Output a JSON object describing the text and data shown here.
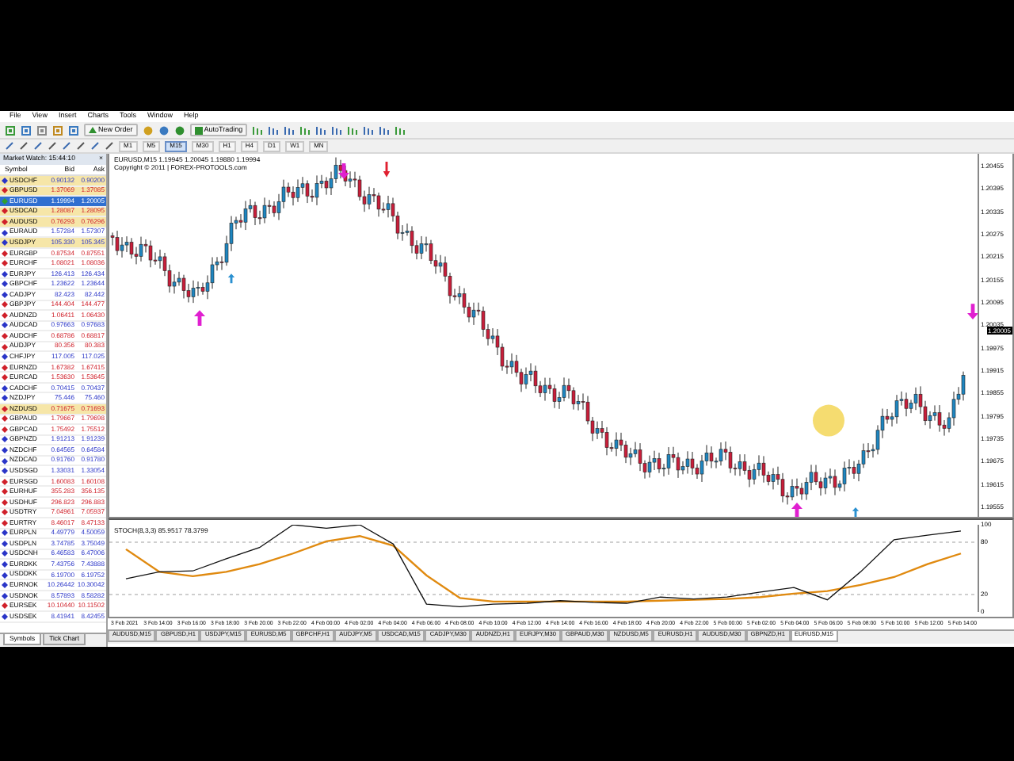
{
  "menu": [
    "File",
    "View",
    "Insert",
    "Charts",
    "Tools",
    "Window",
    "Help"
  ],
  "toolbar": {
    "new_order": "New Order",
    "auto_trading": "AutoTrading"
  },
  "timeframes": [
    {
      "label": "M1",
      "selected": false
    },
    {
      "label": "M5",
      "selected": false
    },
    {
      "label": "M15",
      "selected": true
    },
    {
      "label": "M30",
      "selected": false
    },
    {
      "label": "H1",
      "selected": false
    },
    {
      "label": "H4",
      "selected": false
    },
    {
      "label": "D1",
      "selected": false
    },
    {
      "label": "W1",
      "selected": false
    },
    {
      "label": "MN",
      "selected": false
    }
  ],
  "market_watch": {
    "title": "Market Watch: 15:44:10",
    "close": "×",
    "columns": [
      "Symbol",
      "Bid",
      "Ask"
    ],
    "rows": [
      {
        "symbol": "USDCHF",
        "bid": "0.90132",
        "ask": "0.90200",
        "color": "#2a35c8",
        "highlighted": true,
        "selected": false
      },
      {
        "symbol": "GBPUSD",
        "bid": "1.37069",
        "ask": "1.37085",
        "color": "#d0202a",
        "highlighted": true,
        "selected": false
      },
      {
        "symbol": "EURUSD",
        "bid": "1.19994",
        "ask": "1.20005",
        "highlighted": false,
        "selected": true
      },
      {
        "symbol": "USDCAD",
        "bid": "1.28087",
        "ask": "1.28095",
        "color": "#d0202a",
        "highlighted": true,
        "selected": false
      },
      {
        "symbol": "AUDUSD",
        "bid": "0.76293",
        "ask": "0.76296",
        "color": "#d0202a",
        "highlighted": true,
        "selected": false
      },
      {
        "symbol": "EURAUD",
        "bid": "1.57284",
        "ask": "1.57307",
        "color": "#2a35c8",
        "highlighted": false,
        "selected": false
      },
      {
        "symbol": "USDJPY",
        "bid": "105.330",
        "ask": "105.345",
        "color": "#2a35c8",
        "highlighted": true,
        "selected": false
      },
      {
        "symbol": "EURGBP",
        "bid": "0.87534",
        "ask": "0.87551",
        "color": "#d0202a",
        "highlighted": false,
        "selected": false
      },
      {
        "symbol": "EURCHF",
        "bid": "1.08021",
        "ask": "1.08036",
        "color": "#d0202a",
        "highlighted": false,
        "selected": false
      },
      {
        "symbol": "EURJPY",
        "bid": "126.413",
        "ask": "126.434",
        "color": "#2a35c8",
        "highlighted": false,
        "selected": false
      },
      {
        "symbol": "GBPCHF",
        "bid": "1.23622",
        "ask": "1.23644",
        "color": "#2a35c8",
        "highlighted": false,
        "selected": false
      },
      {
        "symbol": "CADJPY",
        "bid": "82.423",
        "ask": "82.442",
        "color": "#2a35c8",
        "highlighted": false,
        "selected": false
      },
      {
        "symbol": "GBPJPY",
        "bid": "144.404",
        "ask": "144.477",
        "color": "#d0202a",
        "highlighted": false,
        "selected": false
      },
      {
        "symbol": "AUDNZD",
        "bid": "1.06411",
        "ask": "1.06430",
        "color": "#d0202a",
        "highlighted": false,
        "selected": false
      },
      {
        "symbol": "AUDCAD",
        "bid": "0.97663",
        "ask": "0.97683",
        "color": "#2a35c8",
        "highlighted": false,
        "selected": false
      },
      {
        "symbol": "AUDCHF",
        "bid": "0.68786",
        "ask": "0.68817",
        "color": "#d0202a",
        "highlighted": false,
        "selected": false
      },
      {
        "symbol": "AUDJPY",
        "bid": "80.356",
        "ask": "80.383",
        "color": "#d0202a",
        "highlighted": false,
        "selected": false
      },
      {
        "symbol": "CHFJPY",
        "bid": "117.005",
        "ask": "117.025",
        "color": "#2a35c8",
        "highlighted": false,
        "selected": false
      },
      {
        "symbol": "EURNZD",
        "bid": "1.67382",
        "ask": "1.67415",
        "color": "#d0202a",
        "highlighted": false,
        "selected": false
      },
      {
        "symbol": "EURCAD",
        "bid": "1.53630",
        "ask": "1.53645",
        "color": "#d0202a",
        "highlighted": false,
        "selected": false
      },
      {
        "symbol": "CADCHF",
        "bid": "0.70415",
        "ask": "0.70437",
        "color": "#2a35c8",
        "highlighted": false,
        "selected": false
      },
      {
        "symbol": "NZDJPY",
        "bid": "75.446",
        "ask": "75.460",
        "color": "#2a35c8",
        "highlighted": false,
        "selected": false
      },
      {
        "symbol": "NZDUSD",
        "bid": "0.71675",
        "ask": "0.71693",
        "color": "#d0202a",
        "highlighted": true,
        "selected": false
      },
      {
        "symbol": "GBPAUD",
        "bid": "1.79667",
        "ask": "1.79698",
        "color": "#d0202a",
        "highlighted": false,
        "selected": false
      },
      {
        "symbol": "GBPCAD",
        "bid": "1.75492",
        "ask": "1.75512",
        "color": "#d0202a",
        "highlighted": false,
        "selected": false
      },
      {
        "symbol": "GBPNZD",
        "bid": "1.91213",
        "ask": "1.91239",
        "color": "#2a35c8",
        "highlighted": false,
        "selected": false
      },
      {
        "symbol": "NZDCHF",
        "bid": "0.64565",
        "ask": "0.64584",
        "color": "#2a35c8",
        "highlighted": false,
        "selected": false
      },
      {
        "symbol": "NZDCAD",
        "bid": "0.91760",
        "ask": "0.91780",
        "color": "#2a35c8",
        "highlighted": false,
        "selected": false
      },
      {
        "symbol": "USDSGD",
        "bid": "1.33031",
        "ask": "1.33054",
        "color": "#2a35c8",
        "highlighted": false,
        "selected": false
      },
      {
        "symbol": "EURSGD",
        "bid": "1.60083",
        "ask": "1.60108",
        "color": "#d0202a",
        "highlighted": false,
        "selected": false
      },
      {
        "symbol": "EURHUF",
        "bid": "355.283",
        "ask": "356.135",
        "color": "#d0202a",
        "highlighted": false,
        "selected": false
      },
      {
        "symbol": "USDHUF",
        "bid": "296.823",
        "ask": "296.883",
        "color": "#d0202a",
        "highlighted": false,
        "selected": false
      },
      {
        "symbol": "USDTRY",
        "bid": "7.04961",
        "ask": "7.05937",
        "color": "#d0202a",
        "highlighted": false,
        "selected": false
      },
      {
        "symbol": "EURTRY",
        "bid": "8.46017",
        "ask": "8.47133",
        "color": "#d0202a",
        "highlighted": false,
        "selected": false
      },
      {
        "symbol": "EURPLN",
        "bid": "4.49779",
        "ask": "4.50059",
        "color": "#2a35c8",
        "highlighted": false,
        "selected": false
      },
      {
        "symbol": "USDPLN",
        "bid": "3.74785",
        "ask": "3.75049",
        "color": "#2a35c8",
        "highlighted": false,
        "selected": false
      },
      {
        "symbol": "USDCNH",
        "bid": "6.46583",
        "ask": "6.47006",
        "color": "#2a35c8",
        "highlighted": false,
        "selected": false
      },
      {
        "symbol": "EURDKK",
        "bid": "7.43756",
        "ask": "7.43888",
        "color": "#2a35c8",
        "highlighted": false,
        "selected": false
      },
      {
        "symbol": "USDDKK",
        "bid": "6.19700",
        "ask": "6.19752",
        "color": "#2a35c8",
        "highlighted": false,
        "selected": false
      },
      {
        "symbol": "EURNOK",
        "bid": "10.26442",
        "ask": "10.30042",
        "color": "#2a35c8",
        "highlighted": false,
        "selected": false
      },
      {
        "symbol": "USDNOK",
        "bid": "8.57893",
        "ask": "8.58282",
        "color": "#2a35c8",
        "highlighted": false,
        "selected": false
      },
      {
        "symbol": "EURSEK",
        "bid": "10.10440",
        "ask": "10.11502",
        "color": "#d0202a",
        "highlighted": false,
        "selected": false
      },
      {
        "symbol": "USDSEK",
        "bid": "8.41941",
        "ask": "8.42455",
        "color": "#2a35c8",
        "highlighted": false,
        "selected": false
      }
    ],
    "tabs": [
      {
        "label": "Symbols",
        "selected": true
      },
      {
        "label": "Tick Chart",
        "selected": false
      }
    ]
  },
  "chart": {
    "header": "EURUSD,M15  1.19945 1.20045 1.19880 1.19994",
    "copyright": "Copyright © 2011 | FOREX-PROTOOLS.com",
    "price_labels": [
      "1.20455",
      "1.20395",
      "1.20335",
      "1.20275",
      "1.20215",
      "1.20155",
      "1.20095",
      "1.20035",
      "1.19975",
      "1.19915",
      "1.19855",
      "1.19795",
      "1.19735",
      "1.19675",
      "1.19615",
      "1.19555"
    ],
    "current_price": "1.20005",
    "indicator": {
      "label": "STOCH(8,3,3) 85.9517 78.3799",
      "chart_data": {
        "type": "line",
        "categories": [
          "3 Feb 2021",
          "3 Feb 14:00",
          "3 Feb 16:00",
          "3 Feb 18:00",
          "3 Feb 20:00",
          "3 Feb 22:00",
          "4 Feb 00:00",
          "4 Feb 02:00",
          "4 Feb 04:00",
          "4 Feb 06:00",
          "4 Feb 08:00",
          "4 Feb 10:00",
          "4 Feb 12:00",
          "4 Feb 14:00",
          "4 Feb 16:00",
          "4 Feb 18:00",
          "4 Feb 20:00",
          "4 Feb 22:00",
          "5 Feb 00:00",
          "5 Feb 02:00",
          "5 Feb 04:00",
          "5 Feb 06:00",
          "5 Feb 08:00",
          "5 Feb 10:00",
          "5 Feb 12:00",
          "5 Feb 14:00"
        ],
        "ylim": [
          0,
          100
        ],
        "yticks": [
          100,
          80,
          20,
          0
        ],
        "series": [
          {
            "color": "#111111",
            "values": [
              38,
              46,
              47,
              61,
              74,
              100,
              96,
              100,
              78,
              9,
              6,
              9,
              10,
              13,
              11,
              10,
              17,
              15,
              17,
              23,
              28,
              14,
              46,
              83,
              88,
              93
            ]
          },
          {
            "color": "#e08a10",
            "values": [
              72,
              46,
              41,
              46,
              55,
              67,
              81,
              87,
              76,
              42,
              16,
              12,
              12,
              12,
              12,
              12,
              13,
              14,
              15,
              17,
              21,
              24,
              31,
              40,
              55,
              67
            ]
          }
        ]
      }
    }
  },
  "chart_tabs": [
    {
      "label": "AUDUSD,M15",
      "selected": false
    },
    {
      "label": "GBPUSD,H1",
      "selected": false
    },
    {
      "label": "USDJPY,M15",
      "selected": false
    },
    {
      "label": "EURUSD,M5",
      "selected": false
    },
    {
      "label": "GBPCHF,H1",
      "selected": false
    },
    {
      "label": "AUDJPY,M5",
      "selected": false
    },
    {
      "label": "USDCAD,M15",
      "selected": false
    },
    {
      "label": "CADJPY,M30",
      "selected": false
    },
    {
      "label": "AUDNZD,H1",
      "selected": false
    },
    {
      "label": "EURJPY,M30",
      "selected": false
    },
    {
      "label": "GBPAUD,M30",
      "selected": false
    },
    {
      "label": "NZDUSD,M5",
      "selected": false
    },
    {
      "label": "EURUSD,H1",
      "selected": false
    },
    {
      "label": "AUDUSD,M30",
      "selected": false
    },
    {
      "label": "GBPNZD,H1",
      "selected": false
    },
    {
      "label": "EURUSD,M15",
      "selected": true
    }
  ]
}
